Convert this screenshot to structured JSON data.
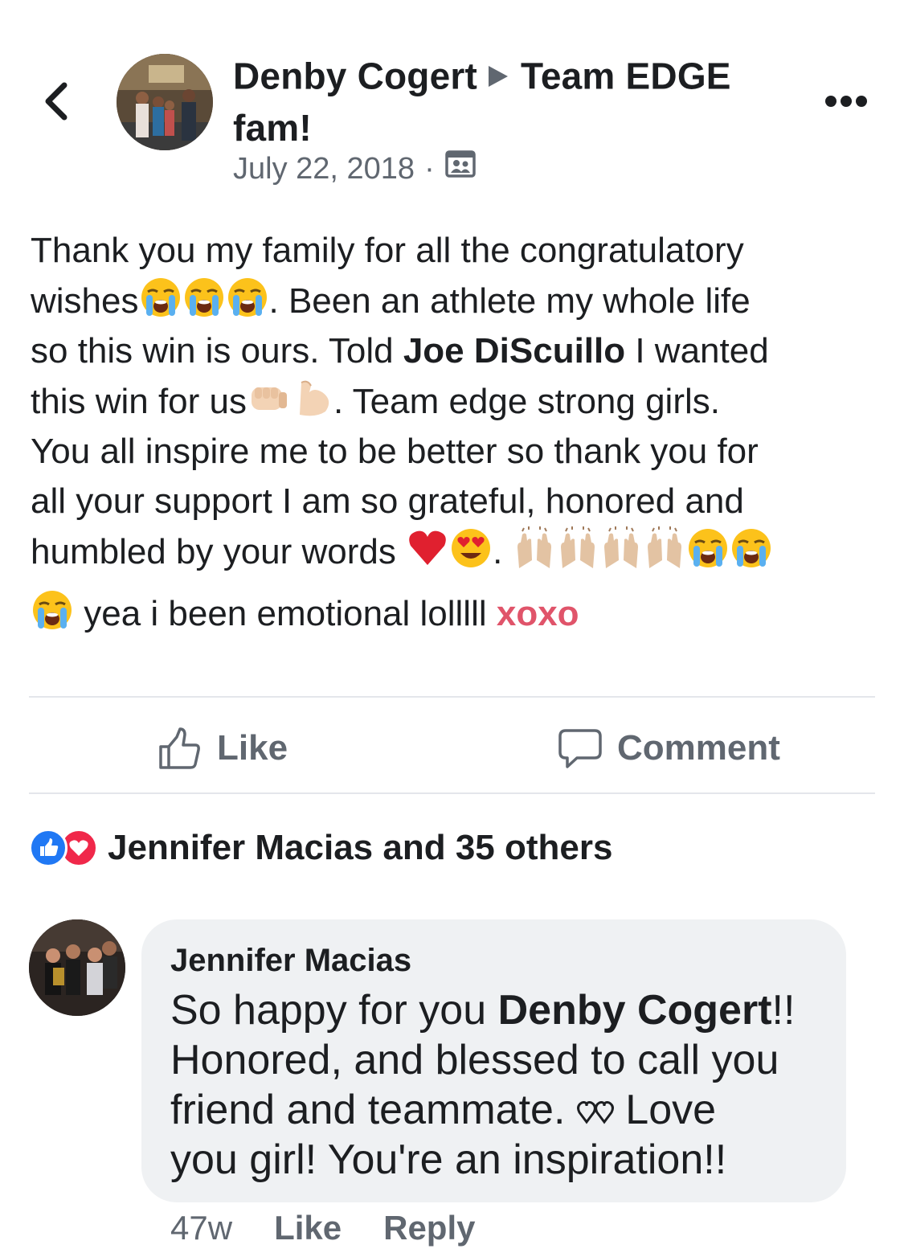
{
  "header": {
    "author": "Denby Cogert",
    "group": "Team EDGE fam!",
    "date": "July 22, 2018",
    "separator": "·",
    "privacy_icon": "group-audience-icon"
  },
  "post": {
    "line1": "Thank you my family for all the congratulatory",
    "l2a": "wishes",
    "l2b": ". Been an athlete my whole life",
    "l3a": "so this win is ours. Told ",
    "mention": "Joe DiScuillo",
    "l3b": " I wanted",
    "l4a": "this win for us",
    "l4b": ". Team edge strong girls.",
    "line5": "You all inspire me to be better so thank you for",
    "line6": "all your support I am so grateful, honored and",
    "l7a": "humbled by your words ",
    "l7b": ". ",
    "l8a": " yea i been emotional lolllll ",
    "xoxo": "xoxo"
  },
  "actions": {
    "like_label": "Like",
    "comment_label": "Comment"
  },
  "reactions": {
    "text": "Jennifer Macias and 35 others"
  },
  "comment": {
    "author": "Jennifer Macias",
    "t1": "So happy for you ",
    "mention": "Denby Cogert",
    "t2": "!!",
    "t3": "Honored, and blessed to call you",
    "t4a": "friend and teammate. ",
    "t4b": " Love",
    "t5": "you girl! You're an inspiration!!",
    "time": "47w",
    "like_label": "Like",
    "reply_label": "Reply"
  },
  "colors": {
    "text": "#1c1e21",
    "secondary": "#606770",
    "xoxo": "#e0546a",
    "like_blue": "#2078f4",
    "love_red": "#f0284a",
    "bubble": "#eff1f3"
  }
}
